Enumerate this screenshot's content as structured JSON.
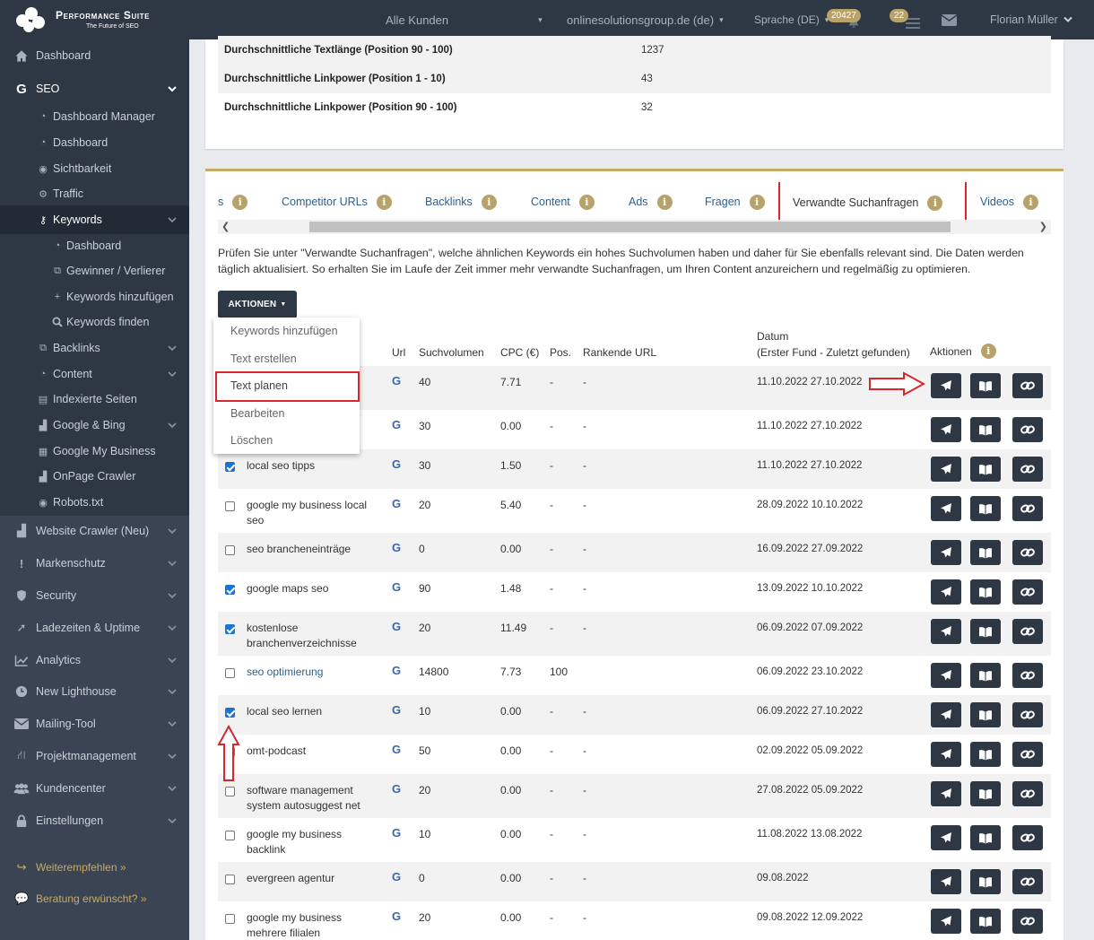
{
  "brand": {
    "title": "Performance Suite",
    "subtitle": "The Future of SEO"
  },
  "topbar": {
    "customer_select": "Alle Kunden",
    "domain_select": "onlinesolutionsgroup.de (de)",
    "language": "Sprache (DE)",
    "notifications_count": "20427",
    "tasks_count": "22",
    "user_name": "Florian Müller"
  },
  "sidebar": {
    "items": [
      {
        "label": "Dashboard",
        "icon": "home-icon"
      },
      {
        "label": "SEO",
        "icon": "google-g-icon"
      },
      {
        "label": "Dashboard Manager",
        "icon": "dashboard-icon"
      },
      {
        "label": "Dashboard",
        "icon": "dashboard-icon"
      },
      {
        "label": "Sichtbarkeit",
        "icon": "eye-icon"
      },
      {
        "label": "Traffic",
        "icon": "cogs-icon"
      },
      {
        "label": "Keywords",
        "icon": "key-icon"
      },
      {
        "label": "Dashboard",
        "icon": "dashboard-icon"
      },
      {
        "label": "Gewinner / Verlierer",
        "icon": "external-link-icon"
      },
      {
        "label": "Keywords hinzufügen",
        "icon": "plus-icon"
      },
      {
        "label": "Keywords finden",
        "icon": "search-icon"
      },
      {
        "label": "Backlinks",
        "icon": "external-link-icon"
      },
      {
        "label": "Content",
        "icon": "dashboard-icon"
      },
      {
        "label": "Indexierte Seiten",
        "icon": "file-icon"
      },
      {
        "label": "Google & Bing",
        "icon": "chart-icon"
      },
      {
        "label": "Google My Business",
        "icon": "store-icon"
      },
      {
        "label": "OnPage Crawler",
        "icon": "chart-icon"
      },
      {
        "label": "Robots.txt",
        "icon": "eye-icon"
      },
      {
        "label": "Website Crawler (Neu)",
        "icon": "chart-icon"
      },
      {
        "label": "Markenschutz",
        "icon": "exclamation-icon"
      },
      {
        "label": "Security",
        "icon": "shield-icon"
      },
      {
        "label": "Ladezeiten & Uptime",
        "icon": "rocket-icon"
      },
      {
        "label": "Analytics",
        "icon": "line-chart-icon"
      },
      {
        "label": "New Lighthouse",
        "icon": "clock-icon"
      },
      {
        "label": "Mailing-Tool",
        "icon": "envelope-icon"
      },
      {
        "label": "Projektmanagement",
        "icon": "road-icon"
      },
      {
        "label": "Kundencenter",
        "icon": "users-icon"
      },
      {
        "label": "Einstellungen",
        "icon": "lock-icon"
      },
      {
        "label": "Weiterempfehlen »",
        "icon": "share-icon"
      },
      {
        "label": "Beratung erwünscht? »",
        "icon": "comments-icon"
      }
    ]
  },
  "stats": [
    {
      "label": "Durchschnittliche Textlänge (Position 90 - 100)",
      "value": "1237"
    },
    {
      "label": "Durchschnittliche Linkpower (Position 1 - 10)",
      "value": "43"
    },
    {
      "label": "Durchschnittliche Linkpower (Position 90 - 100)",
      "value": "32"
    }
  ],
  "tabs": [
    {
      "label": "s"
    },
    {
      "label": "Competitor URLs"
    },
    {
      "label": "Backlinks"
    },
    {
      "label": "Content"
    },
    {
      "label": "Ads"
    },
    {
      "label": "Fragen"
    },
    {
      "label": "Verwandte Suchanfragen"
    },
    {
      "label": "Videos"
    }
  ],
  "description": "Prüfen Sie unter \"Verwandte Suchanfragen\", welche ähnlichen Keywords ein hohes Suchvolumen haben und daher für Sie ebenfalls relevant sind. Die Daten werden täglich aktualisiert. So erhalten Sie im Laufe der Zeit immer mehr verwandte Suchanfragen, um Ihren Content anzureichern und regelmäßig zu optimieren.",
  "actions_button": "AKTIONEN",
  "dropdown": [
    "Keywords hinzufügen",
    "Text erstellen",
    "Text planen",
    "Bearbeiten",
    "Löschen"
  ],
  "table": {
    "headers": {
      "url": "Url",
      "volume": "Suchvolumen",
      "cpc": "CPC (€)",
      "pos": "Pos.",
      "ranking_url": "Rankende URL",
      "date_line1": "Datum",
      "date_line2": "(Erster Fund - Zuletzt gefunden)",
      "actions": "Aktionen"
    },
    "rows": [
      {
        "keyword": "",
        "checked": false,
        "volume": "40",
        "cpc": "7.71",
        "pos": "-",
        "url": "-",
        "date": "11.10.2022 27.10.2022"
      },
      {
        "keyword": "",
        "checked": false,
        "volume": "30",
        "cpc": "0.00",
        "pos": "-",
        "url": "-",
        "date": "11.10.2022 27.10.2022"
      },
      {
        "keyword": "local seo tipps",
        "checked": true,
        "volume": "30",
        "cpc": "1.50",
        "pos": "-",
        "url": "-",
        "date": "11.10.2022 27.10.2022"
      },
      {
        "keyword": "google my business local seo",
        "checked": false,
        "volume": "20",
        "cpc": "5.40",
        "pos": "-",
        "url": "-",
        "date": "28.09.2022 10.10.2022"
      },
      {
        "keyword": "seo brancheneinträge",
        "checked": false,
        "volume": "0",
        "cpc": "0.00",
        "pos": "-",
        "url": "-",
        "date": "16.09.2022 27.09.2022"
      },
      {
        "keyword": "google maps seo",
        "checked": true,
        "volume": "90",
        "cpc": "1.48",
        "pos": "-",
        "url": "-",
        "date": "13.09.2022 10.10.2022"
      },
      {
        "keyword": "kostenlose branchenverzeichnisse",
        "checked": true,
        "volume": "20",
        "cpc": "11.49",
        "pos": "-",
        "url": "-",
        "date": "06.09.2022 07.09.2022"
      },
      {
        "keyword": "seo optimierung",
        "checked": false,
        "volume": "14800",
        "cpc": "7.73",
        "pos": "100",
        "url": "",
        "date": "06.09.2022 23.10.2022"
      },
      {
        "keyword": "local seo lernen",
        "checked": true,
        "volume": "10",
        "cpc": "0.00",
        "pos": "-",
        "url": "-",
        "date": "06.09.2022 27.10.2022"
      },
      {
        "keyword": "omt-podcast",
        "checked": false,
        "volume": "50",
        "cpc": "0.00",
        "pos": "-",
        "url": "-",
        "date": "02.09.2022 05.09.2022"
      },
      {
        "keyword": "software management system autosuggest net",
        "checked": false,
        "volume": "20",
        "cpc": "0.00",
        "pos": "-",
        "url": "-",
        "date": "27.08.2022 05.09.2022"
      },
      {
        "keyword": "google my business backlink",
        "checked": false,
        "volume": "10",
        "cpc": "0.00",
        "pos": "-",
        "url": "-",
        "date": "11.08.2022 13.08.2022"
      },
      {
        "keyword": "evergreen agentur",
        "checked": false,
        "volume": "0",
        "cpc": "0.00",
        "pos": "-",
        "url": "-",
        "date": "09.08.2022"
      },
      {
        "keyword": "google my business mehrere filialen",
        "checked": false,
        "volume": "20",
        "cpc": "0.00",
        "pos": "-",
        "url": "-",
        "date": "09.08.2022 12.09.2022"
      }
    ]
  }
}
